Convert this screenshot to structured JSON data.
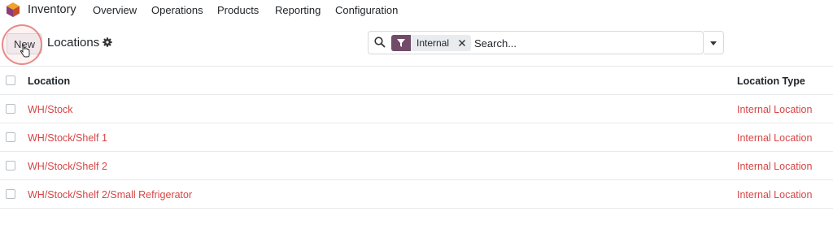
{
  "navbar": {
    "app_name": "Inventory",
    "menu": [
      "Overview",
      "Operations",
      "Products",
      "Reporting",
      "Configuration"
    ]
  },
  "control_panel": {
    "new_label": "New",
    "title": "Locations",
    "settings_icon": "gear-icon"
  },
  "search": {
    "facet_icon": "filter-icon",
    "facet_label": "Internal",
    "placeholder": "Search...",
    "value": ""
  },
  "table": {
    "columns": [
      "Location",
      "Location Type"
    ],
    "rows": [
      {
        "location": "WH/Stock",
        "type": "Internal Location"
      },
      {
        "location": "WH/Stock/Shelf 1",
        "type": "Internal Location"
      },
      {
        "location": "WH/Stock/Shelf 2",
        "type": "Internal Location"
      },
      {
        "location": "WH/Stock/Shelf 2/Small Refrigerator",
        "type": "Internal Location"
      }
    ]
  },
  "colors": {
    "brand": "#714b67",
    "link": "#d64545",
    "border": "#e6e8ea"
  }
}
